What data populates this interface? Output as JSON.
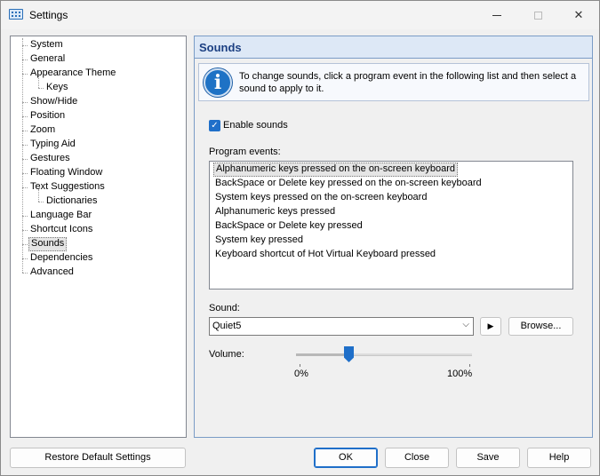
{
  "window": {
    "title": "Settings"
  },
  "tree": {
    "items": [
      {
        "label": "System",
        "level": 0
      },
      {
        "label": "General",
        "level": 0
      },
      {
        "label": "Appearance Theme",
        "level": 0
      },
      {
        "label": "Keys",
        "level": 1
      },
      {
        "label": "Show/Hide",
        "level": 0
      },
      {
        "label": "Position",
        "level": 0
      },
      {
        "label": "Zoom",
        "level": 0
      },
      {
        "label": "Typing Aid",
        "level": 0
      },
      {
        "label": "Gestures",
        "level": 0
      },
      {
        "label": "Floating Window",
        "level": 0
      },
      {
        "label": "Text Suggestions",
        "level": 0
      },
      {
        "label": "Dictionaries",
        "level": 1
      },
      {
        "label": "Language Bar",
        "level": 0
      },
      {
        "label": "Shortcut Icons",
        "level": 0
      },
      {
        "label": "Sounds",
        "level": 0,
        "selected": true
      },
      {
        "label": "Dependencies",
        "level": 0
      },
      {
        "label": "Advanced",
        "level": 0
      }
    ]
  },
  "panel": {
    "header": "Sounds",
    "info": "To change sounds, click a program event in the following list and then select a sound to apply to it.",
    "enable_sounds": {
      "label": "Enable sounds",
      "checked": true
    },
    "events_label": "Program events:",
    "events": [
      {
        "label": "Alphanumeric keys pressed on the on-screen keyboard",
        "selected": true
      },
      {
        "label": "BackSpace or Delete key pressed on the on-screen keyboard"
      },
      {
        "label": "System keys pressed on the on-screen keyboard"
      },
      {
        "label": "Alphanumeric keys pressed"
      },
      {
        "label": "BackSpace or Delete key pressed"
      },
      {
        "label": "System key pressed"
      },
      {
        "label": "Keyboard shortcut of Hot Virtual Keyboard pressed"
      }
    ],
    "sound_label": "Sound:",
    "sound_value": "Quiet5",
    "browse_label": "Browse...",
    "volume_label": "Volume:",
    "volume_min_label": "0%",
    "volume_max_label": "100%",
    "volume_value": 0.3
  },
  "buttons": {
    "restore": "Restore Default Settings",
    "ok": "OK",
    "close": "Close",
    "save": "Save",
    "help": "Help"
  },
  "colors": {
    "accent": "#1f6fc9",
    "header_text": "#1b3f82"
  }
}
